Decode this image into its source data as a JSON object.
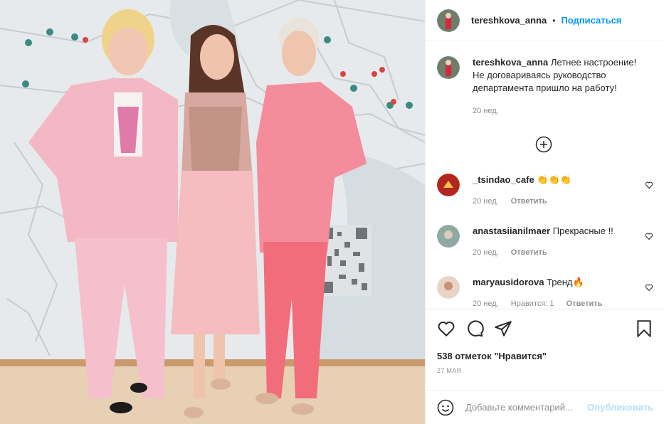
{
  "header": {
    "username": "tereshkova_anna",
    "separator": "•",
    "follow_label": "Подписаться"
  },
  "caption": {
    "username": "tereshkova_anna",
    "text": "Летнее настроение! Не договариваясь руководство департамента пришло на работу!",
    "time": "20 нед."
  },
  "load_more_icon": "plus-circle-icon",
  "comments": [
    {
      "username": "_tsindao_cafe",
      "text": "👏👏👏",
      "time": "20 нед.",
      "reply_label": "Ответить"
    },
    {
      "username": "anastasiianilmaer",
      "text": "Прекрасные !!",
      "time": "20 нед.",
      "reply_label": "Ответить"
    },
    {
      "username": "maryausidorova",
      "text": "Тренд🔥",
      "time": "20 нед.",
      "likes": "Нравится: 1",
      "reply_label": "Ответить"
    }
  ],
  "actions": {
    "icons": [
      "heart-icon",
      "comment-icon",
      "share-icon",
      "bookmark-icon"
    ],
    "likes": "538 отметок \"Нравится\"",
    "date": "27 МАЯ"
  },
  "add_comment": {
    "placeholder": "Добавьте комментарий...",
    "post_label": "Опубликовать"
  },
  "colors": {
    "accent": "#0095f6",
    "post_disabled": "#b2dffc",
    "muted": "#8e8e8e",
    "text": "#262626"
  }
}
